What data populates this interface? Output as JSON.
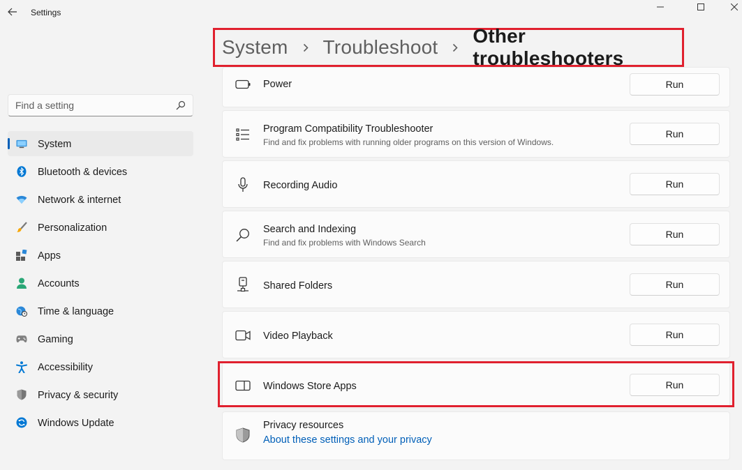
{
  "window": {
    "title": "Settings",
    "icons": {
      "back": "back-arrow-icon",
      "minimize": "minimize-icon",
      "maximize": "maximize-icon",
      "close": "close-icon"
    }
  },
  "search": {
    "placeholder": "Find a setting",
    "value": "",
    "icon": "search-icon"
  },
  "sidebar": {
    "items": [
      {
        "label": "System",
        "icon": "monitor-icon",
        "selected": true
      },
      {
        "label": "Bluetooth & devices",
        "icon": "bluetooth-icon"
      },
      {
        "label": "Network & internet",
        "icon": "wifi-icon"
      },
      {
        "label": "Personalization",
        "icon": "brush-icon"
      },
      {
        "label": "Apps",
        "icon": "apps-icon"
      },
      {
        "label": "Accounts",
        "icon": "person-icon"
      },
      {
        "label": "Time & language",
        "icon": "globe-clock-icon"
      },
      {
        "label": "Gaming",
        "icon": "gamepad-icon"
      },
      {
        "label": "Accessibility",
        "icon": "accessibility-icon"
      },
      {
        "label": "Privacy & security",
        "icon": "shield-icon"
      },
      {
        "label": "Windows Update",
        "icon": "update-icon"
      }
    ]
  },
  "breadcrumb": [
    "System",
    "Troubleshoot",
    "Other troubleshooters"
  ],
  "troubleshooters": [
    {
      "title": "Power",
      "description": "",
      "button": "Run",
      "icon": "battery-icon"
    },
    {
      "title": "Program Compatibility Troubleshooter",
      "description": "Find and fix problems with running older programs on this version of Windows.",
      "button": "Run",
      "icon": "list-icon"
    },
    {
      "title": "Recording Audio",
      "description": "",
      "button": "Run",
      "icon": "microphone-icon"
    },
    {
      "title": "Search and Indexing",
      "description": "Find and fix problems with Windows Search",
      "button": "Run",
      "icon": "search-icon"
    },
    {
      "title": "Shared Folders",
      "description": "",
      "button": "Run",
      "icon": "network-drive-icon"
    },
    {
      "title": "Video Playback",
      "description": "",
      "button": "Run",
      "icon": "video-camera-icon"
    },
    {
      "title": "Windows Store Apps",
      "description": "",
      "button": "Run",
      "icon": "store-app-icon"
    }
  ],
  "privacy": {
    "title": "Privacy resources",
    "link": "About these settings and your privacy",
    "icon": "shield-icon"
  },
  "colors": {
    "accent": "#005fb8",
    "highlight": "#e0202e"
  }
}
